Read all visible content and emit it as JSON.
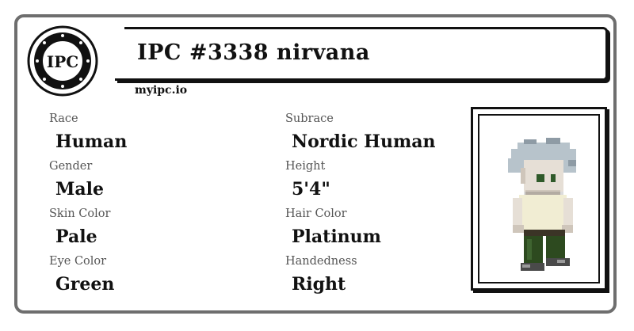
{
  "card": {
    "title": "IPC #3338 nirvana",
    "site": "myipc.io",
    "logo_text": "IPC"
  },
  "attributes": [
    {
      "label": "Race",
      "value": "Human"
    },
    {
      "label": "Subrace",
      "value": "Nordic Human"
    },
    {
      "label": "Gender",
      "value": "Male"
    },
    {
      "label": "Height",
      "value": "5'4\""
    },
    {
      "label": "Skin Color",
      "value": "Pale"
    },
    {
      "label": "Hair Color",
      "value": "Platinum"
    },
    {
      "label": "Eye Color",
      "value": "Green"
    },
    {
      "label": "Handedness",
      "value": "Right"
    }
  ],
  "colors": {
    "border": "#6e6e6e",
    "hair": "#b7c3cb",
    "skin": "#e6dfd6",
    "shirt": "#f1edd3",
    "pants": "#2d4a1f"
  }
}
